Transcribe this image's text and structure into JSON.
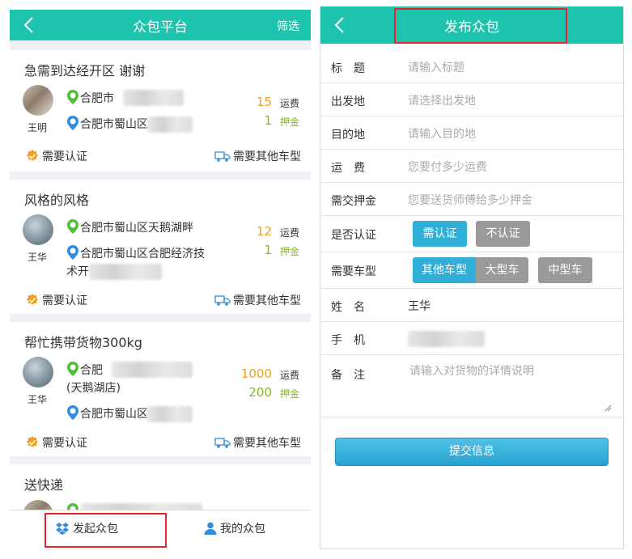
{
  "left": {
    "header": {
      "title": "众包平台",
      "action": "筛选"
    },
    "cards": [
      {
        "title": "急需到达经开区 谢谢",
        "user": "王明",
        "from": "合肥市",
        "to": "合肥市蜀山区",
        "to_extra": "",
        "fee": "15",
        "fee_unit": "运费",
        "deposit": "1",
        "deposit_unit": "押金",
        "auth": "需要认证",
        "car": "需要其他车型"
      },
      {
        "title": "风格的风格",
        "user": "王华",
        "from": "合肥市蜀山区天鹅湖畔",
        "to": "合肥市蜀山区合肥经济技",
        "to_extra": "术开",
        "fee": "12",
        "fee_unit": "运费",
        "deposit": "1",
        "deposit_unit": "押金",
        "auth": "需要认证",
        "car": "需要其他车型"
      },
      {
        "title": "帮忙携带货物300kg",
        "user": "王华",
        "from": "合肥",
        "from_extra": "(天鹅湖店)",
        "to": "合肥市蜀山区",
        "fee": "1000",
        "fee_unit": "运费",
        "deposit": "200",
        "deposit_unit": "押金",
        "auth": "需要认证",
        "car": "需要其他车型"
      },
      {
        "title": "送快递"
      }
    ],
    "bottom_nav": {
      "publish": "发起众包",
      "mine": "我的众包"
    }
  },
  "right": {
    "header": {
      "title": "发布众包"
    },
    "fields": {
      "title_label": "标　题",
      "title_placeholder": "请输入标题",
      "origin_label": "出发地",
      "origin_placeholder": "请选择出发地",
      "dest_label": "目的地",
      "dest_placeholder": "请输入目的地",
      "fee_label": "运　费",
      "fee_placeholder": "您要付多少运费",
      "deposit_label": "需交押金",
      "deposit_placeholder": "您要送货师傅给多少押金",
      "auth_label": "是否认证",
      "auth_yes": "需认证",
      "auth_no": "不认证",
      "car_label": "需要车型",
      "car_other": "其他车型",
      "car_large": "大型车",
      "car_medium": "中型车",
      "name_label": "姓　名",
      "name_value": "王华",
      "phone_label": "手　机",
      "note_label": "备　注",
      "note_placeholder": "请输入对货物的详情说明"
    },
    "submit": "提交信息"
  },
  "colors": {
    "header": "#1ec3ad",
    "accent_blue": "#2faed6",
    "orange": "#f0a020",
    "green": "#85b820",
    "highlight": "#e8222a"
  }
}
